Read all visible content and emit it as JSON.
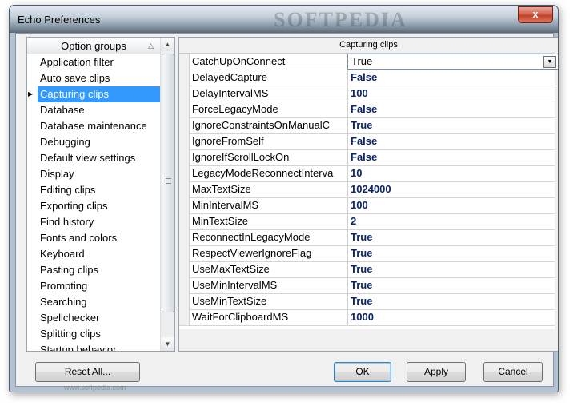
{
  "window": {
    "title": "Echo Preferences",
    "close_glyph": "x",
    "watermark": "SOFTPEDIA"
  },
  "groups": {
    "header": "Option groups",
    "selected": "Capturing clips",
    "items": [
      "Application filter",
      "Auto save clips",
      "Capturing clips",
      "Database",
      "Database maintenance",
      "Debugging",
      "Default view settings",
      "Display",
      "Editing clips",
      "Exporting clips",
      "Find history",
      "Fonts and colors",
      "Keyboard",
      "Pasting clips",
      "Prompting",
      "Searching",
      "Spellchecker",
      "Splitting clips",
      "Startup behavior"
    ]
  },
  "properties": {
    "header": "Capturing clips",
    "rows": [
      {
        "name": "CatchUpOnConnect",
        "value": "True"
      },
      {
        "name": "DelayedCapture",
        "value": "False"
      },
      {
        "name": "DelayIntervalMS",
        "value": "100"
      },
      {
        "name": "ForceLegacyMode",
        "value": "False"
      },
      {
        "name": "IgnoreConstraintsOnManualC",
        "value": "True"
      },
      {
        "name": "IgnoreFromSelf",
        "value": "False"
      },
      {
        "name": "IgnoreIfScrollLockOn",
        "value": "False"
      },
      {
        "name": "LegacyModeReconnectInterva",
        "value": "10"
      },
      {
        "name": "MaxTextSize",
        "value": "1024000"
      },
      {
        "name": "MinIntervalMS",
        "value": "100"
      },
      {
        "name": "MinTextSize",
        "value": "2"
      },
      {
        "name": "ReconnectInLegacyMode",
        "value": "True"
      },
      {
        "name": "RespectViewerIgnoreFlag",
        "value": "True"
      },
      {
        "name": "UseMaxTextSize",
        "value": "True"
      },
      {
        "name": "UseMinIntervalMS",
        "value": "True"
      },
      {
        "name": "UseMinTextSize",
        "value": "True"
      },
      {
        "name": "WaitForClipboardMS",
        "value": "1000"
      }
    ]
  },
  "buttons": {
    "reset": "Reset All...",
    "ok": "OK",
    "apply": "Apply",
    "cancel": "Cancel"
  },
  "footer_watermark": "www.softpedia.com"
}
